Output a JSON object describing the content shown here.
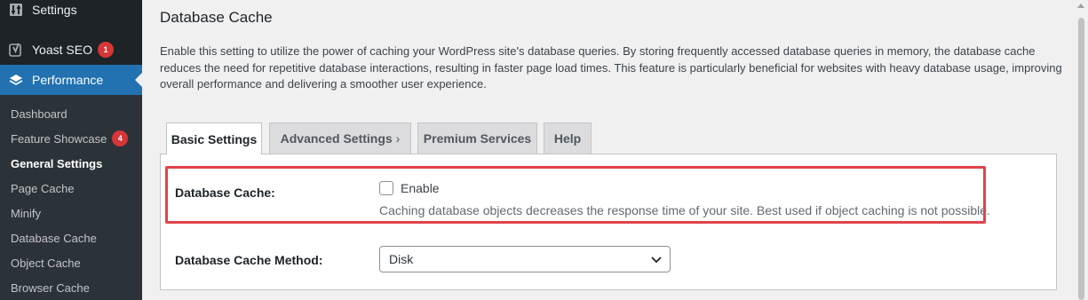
{
  "sidebar": {
    "top_items": [
      {
        "label": "Settings",
        "icon": "settings-icon"
      },
      {
        "label": "Yoast SEO",
        "icon": "yoast-icon",
        "badge": "1"
      },
      {
        "label": "Performance",
        "icon": "performance-icon"
      }
    ],
    "submenu": [
      {
        "label": "Dashboard"
      },
      {
        "label": "Feature Showcase",
        "badge": "4"
      },
      {
        "label": "General Settings"
      },
      {
        "label": "Page Cache"
      },
      {
        "label": "Minify"
      },
      {
        "label": "Database Cache"
      },
      {
        "label": "Object Cache"
      },
      {
        "label": "Browser Cache"
      }
    ]
  },
  "main": {
    "title": "Database Cache",
    "description": "Enable this setting to utilize the power of caching your WordPress site's database queries. By storing frequently accessed database queries in memory, the database cache reduces the need for repetitive database interactions, resulting in faster page load times. This feature is particularly beneficial for websites with heavy database usage, improving overall performance and delivering a smoother user experience.",
    "tabs": [
      {
        "label": "Basic Settings"
      },
      {
        "label": "Advanced Settings",
        "chevron": "›"
      },
      {
        "label": "Premium Services"
      },
      {
        "label": "Help"
      }
    ],
    "settings": {
      "db_cache_label": "Database Cache:",
      "enable_label": "Enable",
      "enable_checked": false,
      "db_cache_help": "Caching database objects decreases the response time of your site. Best used if object caching is not possible.",
      "method_label": "Database Cache Method:",
      "method_value": "Disk"
    }
  },
  "colors": {
    "sidebar_bg": "#1d2327",
    "active_menu": "#2271b1",
    "badge": "#d63638",
    "highlight": "#e0434b"
  }
}
